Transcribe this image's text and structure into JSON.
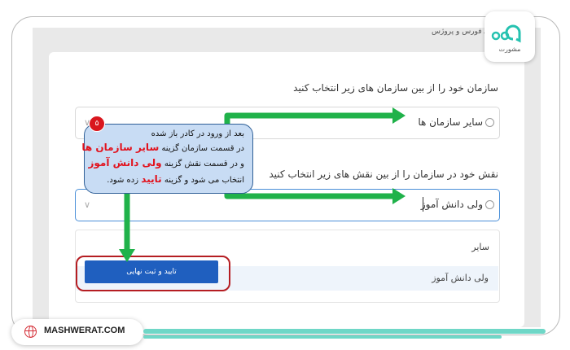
{
  "page": {
    "header_fragment": "... ورود ــ فورس و پروژس",
    "colors": {
      "arrow": "#20b24a",
      "highlight": "#e2111c",
      "button": "#1f5fbf",
      "ring": "#b51d22",
      "callout_bg": "#c8dcf4"
    }
  },
  "form": {
    "org_label": "سازمان خود را از بین سازمان های زیر انتخاب کنید",
    "org_value": "سایر سازمان ها",
    "role_label": "نقش خود در سازمان را از بین نقش های زیر انتخاب کنید",
    "role_value": "ولی دانش آموز",
    "dropdown": {
      "group": "سایر",
      "selected": "ولی دانش آموز"
    },
    "confirm_button": "تایید و ثبت نهایی"
  },
  "callout": {
    "step": "۵",
    "line1": "بعد از ورود در کادر باز شده",
    "line2_pre": "در قسمت سازمان گزینه",
    "line2_hl": "سایر سازمان ها",
    "line3_pre": "و در قسمت نقش گزینه",
    "line3_hl": "ولی دانش آموز",
    "line4_pre": "انتخاب می شود و گزینه",
    "line4_hl": "تایید",
    "line4_post": "زده شود."
  },
  "branding": {
    "logo_text": "مشورت",
    "footer_site": "MASHWERAT.COM"
  }
}
